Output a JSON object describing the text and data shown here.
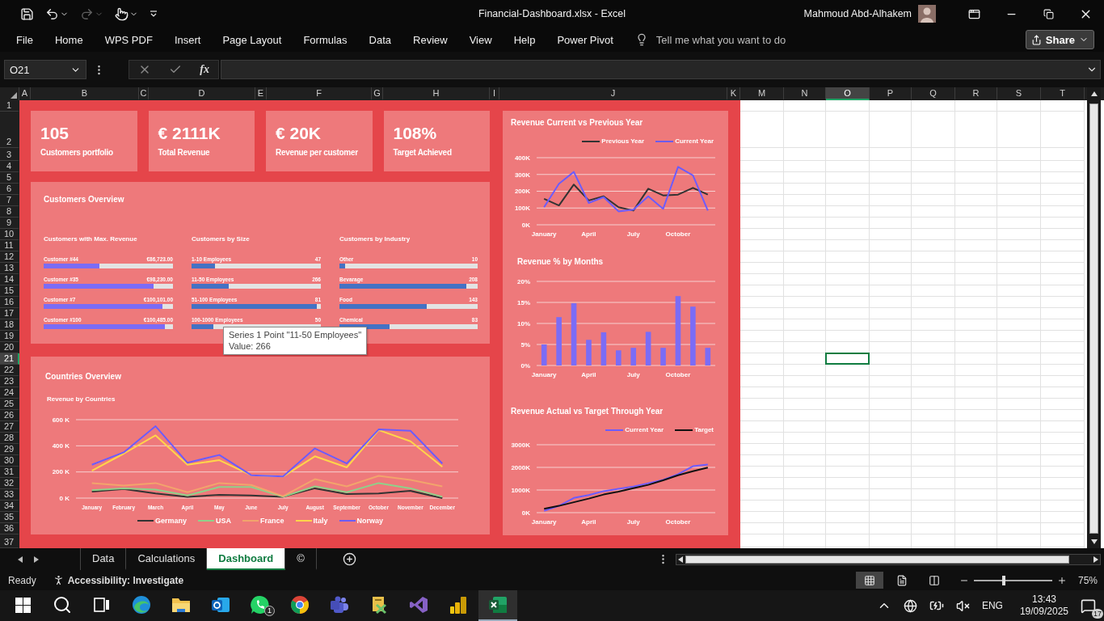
{
  "title_bar": {
    "quick_access": [
      {
        "kind": "save",
        "disabled": false,
        "dropdown": false
      },
      {
        "kind": "undo",
        "disabled": false,
        "dropdown": true
      },
      {
        "kind": "redo",
        "disabled": true,
        "dropdown": true
      },
      {
        "kind": "touch",
        "disabled": false,
        "dropdown": true
      },
      {
        "kind": "customize",
        "disabled": false,
        "dropdown": false
      }
    ],
    "title": "Financial-Dashboard.xlsx  -  Excel",
    "user": "Mahmoud Abd-Alhakem"
  },
  "menu": {
    "items": [
      "File",
      "Home",
      "WPS PDF",
      "Insert",
      "Page Layout",
      "Formulas",
      "Data",
      "Review",
      "View",
      "Help",
      "Power Pivot"
    ],
    "tell_me": {
      "placeholder": "Tell me what you want to do"
    },
    "share": "Share"
  },
  "formula_bar": {
    "name_box": "O21",
    "function_label": "fx"
  },
  "columns": [
    {
      "label": "A",
      "selected": false
    },
    {
      "label": "B",
      "selected": false
    },
    {
      "label": "C",
      "selected": false
    },
    {
      "label": "D",
      "selected": false
    },
    {
      "label": "E",
      "selected": false
    },
    {
      "label": "F",
      "selected": false
    },
    {
      "label": "G",
      "selected": false
    },
    {
      "label": "H",
      "selected": false
    },
    {
      "label": "I",
      "selected": false
    },
    {
      "label": "J",
      "selected": false
    },
    {
      "label": "K",
      "selected": false
    },
    {
      "label": "M",
      "selected": false
    },
    {
      "label": "N",
      "selected": false
    },
    {
      "label": "O",
      "selected": true
    },
    {
      "label": "P",
      "selected": false
    },
    {
      "label": "Q",
      "selected": false
    },
    {
      "label": "R",
      "selected": false
    },
    {
      "label": "S",
      "selected": false
    },
    {
      "label": "T",
      "selected": false
    }
  ],
  "rows": [
    {
      "label": "1",
      "selected": false
    },
    {
      "label": "2",
      "selected": false
    },
    {
      "label": "3",
      "selected": false
    },
    {
      "label": "4",
      "selected": false
    },
    {
      "label": "5",
      "selected": false
    },
    {
      "label": "6",
      "selected": false
    },
    {
      "label": "7",
      "selected": false
    },
    {
      "label": "8",
      "selected": false
    },
    {
      "label": "9",
      "selected": false
    },
    {
      "label": "10",
      "selected": false
    },
    {
      "label": "11",
      "selected": false
    },
    {
      "label": "12",
      "selected": false
    },
    {
      "label": "13",
      "selected": false
    },
    {
      "label": "14",
      "selected": false
    },
    {
      "label": "15",
      "selected": false
    },
    {
      "label": "16",
      "selected": false
    },
    {
      "label": "17",
      "selected": false
    },
    {
      "label": "18",
      "selected": false
    },
    {
      "label": "19",
      "selected": false
    },
    {
      "label": "20",
      "selected": false
    },
    {
      "label": "21",
      "selected": true
    },
    {
      "label": "22",
      "selected": false
    },
    {
      "label": "23",
      "selected": false
    },
    {
      "label": "24",
      "selected": false
    },
    {
      "label": "25",
      "selected": false
    },
    {
      "label": "26",
      "selected": false
    },
    {
      "label": "27",
      "selected": false
    },
    {
      "label": "28",
      "selected": false
    },
    {
      "label": "29",
      "selected": false
    },
    {
      "label": "30",
      "selected": false
    },
    {
      "label": "31",
      "selected": false
    },
    {
      "label": "32",
      "selected": false
    },
    {
      "label": "33",
      "selected": false
    },
    {
      "label": "34",
      "selected": false
    },
    {
      "label": "35",
      "selected": false
    },
    {
      "label": "36",
      "selected": false
    },
    {
      "label": "37",
      "selected": false
    }
  ],
  "dashboard": {
    "kpis": [
      {
        "value": "105",
        "label": "Customers portfolio"
      },
      {
        "value": "€ 2111K",
        "label": "Total Revenue"
      },
      {
        "value": "€ 20K",
        "label": "Revenue per customer"
      },
      {
        "value": "108%",
        "label": "Target Achieved"
      }
    ],
    "customers_overview": {
      "title": "Customers Overview",
      "sections": [
        {
          "title": "Customers with Max. Revenue",
          "color": "#7b6cf6",
          "items": [
            {
              "name": "Customer #44",
              "value": "€86,723.00",
              "level": 0.43
            },
            {
              "name": "Customer #35",
              "value": "€98,230.00",
              "level": 0.85
            },
            {
              "name": "Customer #7",
              "value": "€100,101.00",
              "level": 0.92
            },
            {
              "name": "Customer #100",
              "value": "€100,485.00",
              "level": 0.94
            }
          ]
        },
        {
          "title": "Customers by Size",
          "color": "#4472c4",
          "items": [
            {
              "name": "1-10 Employees",
              "value": "47",
              "level": 0.18
            },
            {
              "name": "11-50 Employees",
              "value": "266",
              "level": 0.29
            },
            {
              "name": "51-100 Employees",
              "value": "81",
              "level": 0.97
            },
            {
              "name": "100-1000 Employees",
              "value": "50",
              "level": 0.17
            }
          ]
        },
        {
          "title": "Customers by Industry",
          "color": "#4472c4",
          "items": [
            {
              "name": "Other",
              "value": "10",
              "level": 0.04
            },
            {
              "name": "Bevarage",
              "value": "208",
              "level": 0.92
            },
            {
              "name": "Food",
              "value": "143",
              "level": 0.63
            },
            {
              "name": "Chemical",
              "value": "83",
              "level": 0.36
            }
          ]
        }
      ],
      "tooltip": {
        "line_1": "Series 1 Point \"11-50 Employees\"",
        "line_2": "Value: 266"
      }
    },
    "countries_overview": {
      "title": "Countries Overview",
      "chart_data": {
        "type": "line",
        "title": "Revenue by Countries",
        "categories": [
          "January",
          "February",
          "March",
          "April",
          "May",
          "June",
          "July",
          "August",
          "September",
          "October",
          "November",
          "December"
        ],
        "legend": true,
        "grid": true,
        "ylim": [
          0,
          600
        ],
        "yticks": [
          {
            "value": 0,
            "label": "0 K"
          },
          {
            "value": 200,
            "label": "200 K"
          },
          {
            "value": 400,
            "label": "400 K"
          },
          {
            "value": 600,
            "label": "600 K"
          }
        ],
        "series": [
          {
            "name": "Germany",
            "color": "#333333",
            "values": [
              50,
              70,
              35,
              10,
              25,
              20,
              10,
              75,
              30,
              35,
              55,
              0
            ]
          },
          {
            "name": "USA",
            "color": "#8fd18a",
            "values": [
              60,
              75,
              65,
              20,
              85,
              85,
              10,
              90,
              45,
              115,
              75,
              10
            ]
          },
          {
            "name": "France",
            "color": "#f2a46c",
            "values": [
              115,
              95,
              115,
              45,
              115,
              100,
              15,
              145,
              90,
              170,
              140,
              90
            ]
          },
          {
            "name": "Italy",
            "color": "#ffd54a",
            "values": [
              210,
              340,
              480,
              255,
              290,
              175,
              165,
              320,
              235,
              520,
              435,
              240
            ]
          },
          {
            "name": "Norway",
            "color": "#6c5cff",
            "values": [
              255,
              350,
              550,
              270,
              330,
              175,
              165,
              380,
              265,
              525,
              515,
              265
            ]
          }
        ]
      }
    },
    "side_charts": [
      {
        "chart_data": {
          "type": "line",
          "title": "Revenue Current vs Previous Year",
          "categories": [
            "January",
            null,
            null,
            "April",
            null,
            null,
            "July",
            null,
            null,
            "October",
            null,
            null
          ],
          "legend": true,
          "grid": true,
          "ylim": [
            0,
            400
          ],
          "yticks": [
            {
              "value": 0,
              "label": "0K"
            },
            {
              "value": 100,
              "label": "100K"
            },
            {
              "value": 200,
              "label": "200K"
            },
            {
              "value": 300,
              "label": "300K"
            },
            {
              "value": 400,
              "label": "400K"
            }
          ],
          "series": [
            {
              "name": "Previous Year",
              "color": "#333333",
              "values": [
                155,
                115,
                240,
                145,
                170,
                105,
                85,
                215,
                175,
                180,
                220,
                180
              ]
            },
            {
              "name": "Current Year",
              "color": "#6c5cff",
              "values": [
                105,
                245,
                315,
                130,
                165,
                80,
                90,
                170,
                95,
                345,
                295,
                85
              ]
            }
          ]
        }
      },
      {
        "chart_data": {
          "type": "bar",
          "title": "Revenue % by Months",
          "categories": [
            "January",
            null,
            null,
            "April",
            null,
            null,
            "July",
            null,
            null,
            "October",
            null,
            null
          ],
          "grid": true,
          "ylim": [
            0,
            20
          ],
          "yticks": [
            {
              "value": 0,
              "label": "0%"
            },
            {
              "value": 5,
              "label": "5%"
            },
            {
              "value": 10,
              "label": "10%"
            },
            {
              "value": 15,
              "label": "15%"
            },
            {
              "value": 20,
              "label": "20%"
            }
          ],
          "series": [
            {
              "color": "#7b6cf6",
              "values": [
                5,
                11.5,
                14.8,
                6.1,
                7.9,
                3.6,
                4.2,
                8,
                4.2,
                16.5,
                14,
                4.2
              ]
            }
          ]
        }
      },
      {
        "chart_data": {
          "type": "line",
          "title": "Revenue Actual vs Target Through Year",
          "categories": [
            "January",
            null,
            null,
            "April",
            null,
            null,
            "July",
            null,
            null,
            "October",
            null,
            null
          ],
          "legend": true,
          "grid": true,
          "ylim": [
            0,
            3000
          ],
          "yticks": [
            {
              "value": 0,
              "label": "0K"
            },
            {
              "value": 1000,
              "label": "1000K"
            },
            {
              "value": 2000,
              "label": "2000K"
            },
            {
              "value": 3000,
              "label": "3000K"
            }
          ],
          "series": [
            {
              "name": "Current Year",
              "color": "#6c5cff",
              "values": [
                80,
                300,
                650,
                780,
                950,
                1050,
                1150,
                1300,
                1450,
                1700,
                2050,
                2130
              ]
            },
            {
              "name": "Target",
              "color": "#111111",
              "values": [
                170,
                300,
                460,
                620,
                800,
                930,
                1080,
                1230,
                1430,
                1650,
                1830,
                1990
              ]
            }
          ]
        }
      }
    ]
  },
  "sheet_tabs": [
    {
      "label": "Data",
      "selected": false
    },
    {
      "label": "Calculations",
      "selected": false
    },
    {
      "label": "Dashboard",
      "selected": true
    },
    {
      "label": "©",
      "selected": false
    }
  ],
  "status_bar": {
    "status": "Ready",
    "accessibility": "Accessibility: Investigate",
    "views": [
      {
        "kind": "normal",
        "selected": true
      },
      {
        "kind": "page_layout",
        "selected": false
      },
      {
        "kind": "page_break",
        "selected": false
      }
    ],
    "zoom": {
      "level": 0.38,
      "reading": "75%"
    }
  },
  "taskbar": {
    "apps": [
      {
        "kind": "start",
        "selected": false
      },
      {
        "kind": "search",
        "selected": false
      },
      {
        "kind": "taskview",
        "selected": false
      },
      {
        "kind": "edge",
        "selected": false
      },
      {
        "kind": "files",
        "selected": false
      },
      {
        "kind": "mail",
        "selected": false
      },
      {
        "kind": "chat",
        "selected": false,
        "badge": "1"
      },
      {
        "kind": "chrome",
        "selected": false
      },
      {
        "kind": "teams",
        "selected": false
      },
      {
        "kind": "tool",
        "selected": false
      },
      {
        "kind": "studio",
        "selected": false
      },
      {
        "kind": "bi",
        "selected": false
      },
      {
        "kind": "sheet",
        "selected": true
      }
    ],
    "tray": {
      "language": "ENG",
      "time": "13:43",
      "date": "19/09/2025",
      "notifications": "17"
    }
  }
}
